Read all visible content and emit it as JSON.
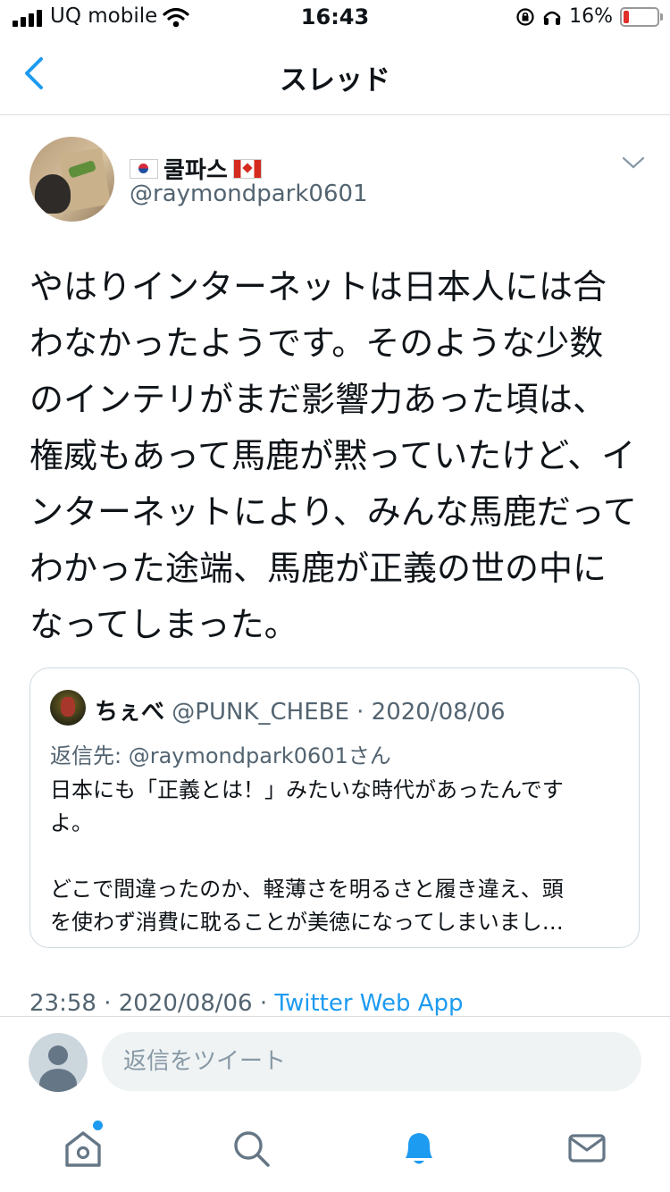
{
  "status_bar": {
    "carrier": "UQ mobile",
    "time": "16:43",
    "battery_percent_label": "16%",
    "battery_level": 0.16
  },
  "nav": {
    "title": "スレッド"
  },
  "tweet": {
    "display_name": "쿨파스",
    "handle": "@raymondpark0601",
    "text": "やはりインターネットは日本人には合わなかったようです。そのような少数のインテリがまだ影響力あった頃は、権威もあって馬鹿が黙っていたけど、インターネットにより、みんな馬鹿だってわかった途端、馬鹿が正義の世の中になってしまった。",
    "timestamp": "23:58 · 2020/08/06 · ",
    "source": "Twitter Web App"
  },
  "quote": {
    "name": "ちぇべ",
    "meta": " @PUNK_CHEBE · 2020/08/06",
    "reply_to": "返信先: @raymondpark0601さん",
    "text_line1": "日本にも「正義とは！」みたいな時代があったんです",
    "text_line2": "よ。",
    "text_line3": "どこで間違ったのか、軽薄さを明るさと履き違え、頭",
    "text_line4": "を使わず消費に耽ることが美徳になってしまいまし…"
  },
  "reply_bar": {
    "placeholder": "返信をツイート"
  },
  "colors": {
    "accent": "#1d9bf0",
    "secondary_text": "#536471",
    "battery_low": "#e0302a"
  },
  "icons": [
    "back-chevron-icon",
    "more-chevron-icon",
    "home-icon",
    "search-icon",
    "notifications-bell-icon",
    "messages-envelope-icon"
  ]
}
